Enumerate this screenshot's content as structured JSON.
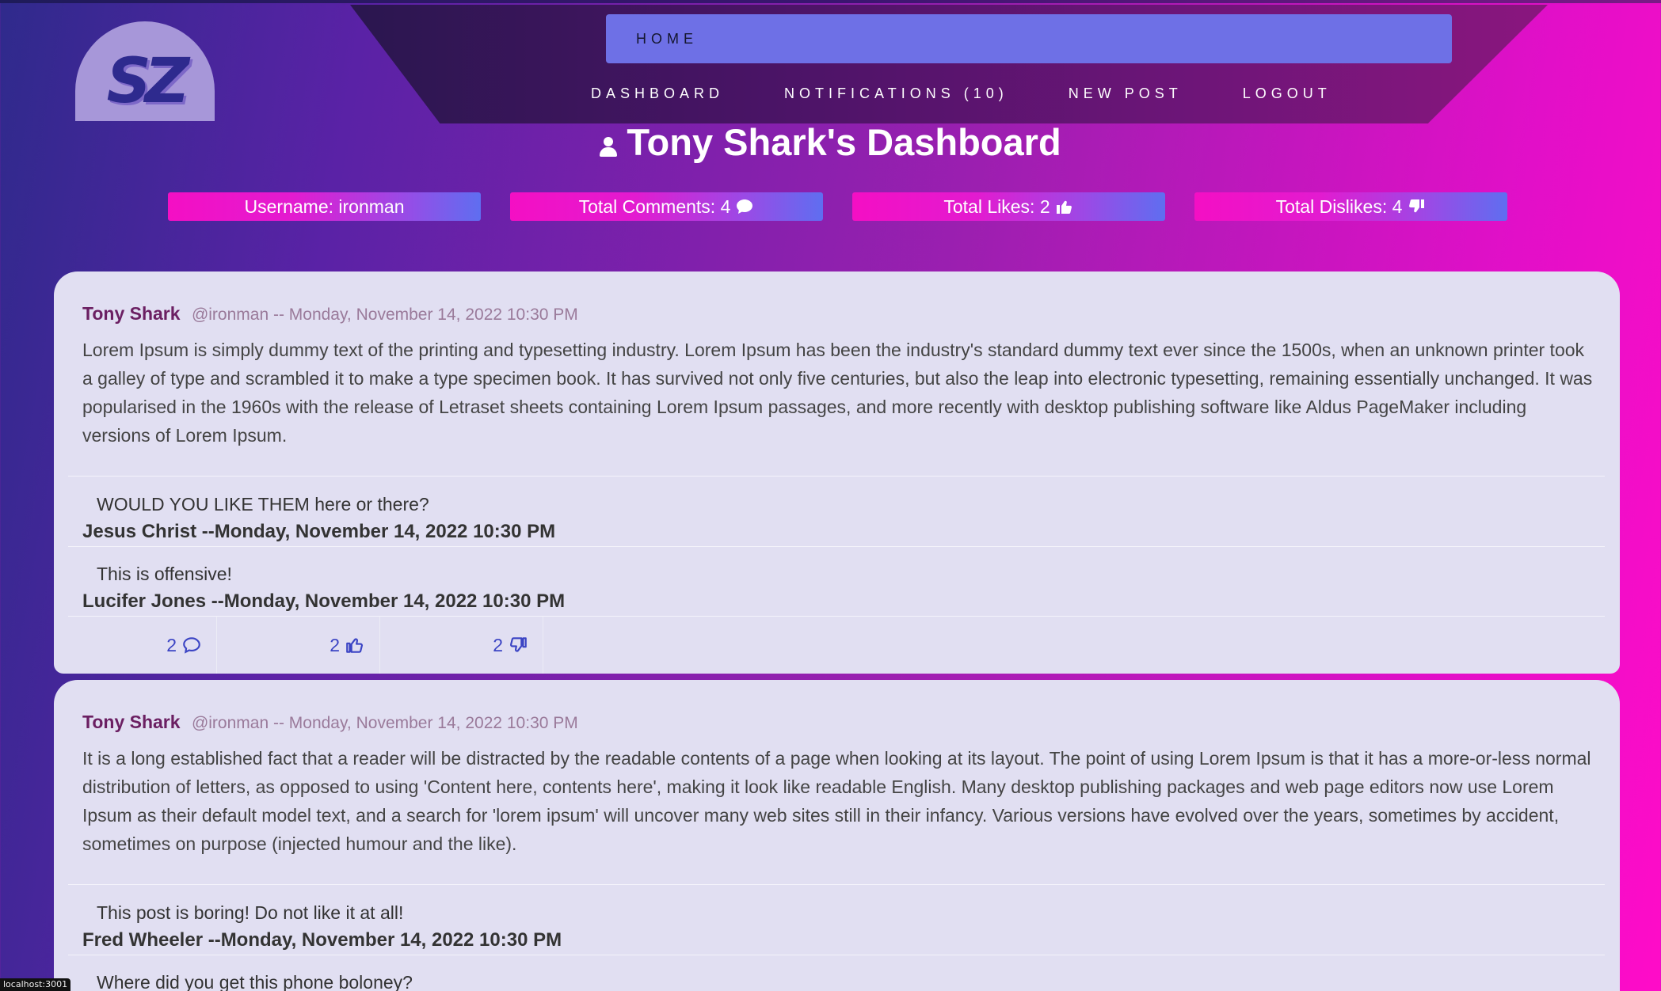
{
  "logo": {
    "text": "SZ"
  },
  "nav": {
    "home": "HOME",
    "links": [
      "DASHBOARD",
      "NOTIFICATIONS (10)",
      "NEW POST",
      "LOGOUT"
    ]
  },
  "title": "Tony Shark's Dashboard",
  "stats": {
    "username": "Username: ironman",
    "comments": "Total Comments: 4",
    "likes": "Total Likes: 2",
    "dislikes": "Total Dislikes: 4"
  },
  "posts": [
    {
      "author": "Tony Shark",
      "meta": "@ironman -- Monday, November 14, 2022 10:30 PM",
      "body": "Lorem Ipsum is simply dummy text of the printing and typesetting industry. Lorem Ipsum has been the industry's standard dummy text ever since the 1500s, when an unknown printer took a galley of type and scrambled it to make a type specimen book. It has survived not only five centuries, but also the leap into electronic typesetting, remaining essentially unchanged. It was popularised in the 1960s with the release of Letraset sheets containing Lorem Ipsum passages, and more recently with desktop publishing software like Aldus PageMaker including versions of Lorem Ipsum.",
      "comments": [
        {
          "text": "WOULD YOU LIKE THEM here or there?",
          "author": "Jesus Christ --Monday, November 14, 2022 10:30 PM"
        },
        {
          "text": "This is offensive!",
          "author": "Lucifer Jones --Monday, November 14, 2022 10:30 PM"
        }
      ],
      "counts": {
        "comments": "2",
        "likes": "2",
        "dislikes": "2"
      }
    },
    {
      "author": "Tony Shark",
      "meta": "@ironman -- Monday, November 14, 2022 10:30 PM",
      "body": "It is a long established fact that a reader will be distracted by the readable contents of a page when looking at its layout. The point of using Lorem Ipsum is that it has a more-or-less normal distribution of letters, as opposed to using 'Content here, contents here', making it look like readable English. Many desktop publishing packages and web page editors now use Lorem Ipsum as their default model text, and a search for 'lorem ipsum' will uncover many web sites still in their infancy. Various versions have evolved over the years, sometimes by accident, sometimes on purpose (injected humour and the like).",
      "comments": [
        {
          "text": "This post is boring! Do not like it at all!",
          "author": "Fred Wheeler --Monday, November 14, 2022 10:30 PM"
        },
        {
          "text": "Where did you get this phone boloney?"
        }
      ]
    }
  ],
  "status_bar": "localhost:3001",
  "colors": {
    "accent": "#6e70e6",
    "stat_pink": "#f40fc4",
    "author": "#6b1f62",
    "action_blue": "#3b44c4"
  }
}
